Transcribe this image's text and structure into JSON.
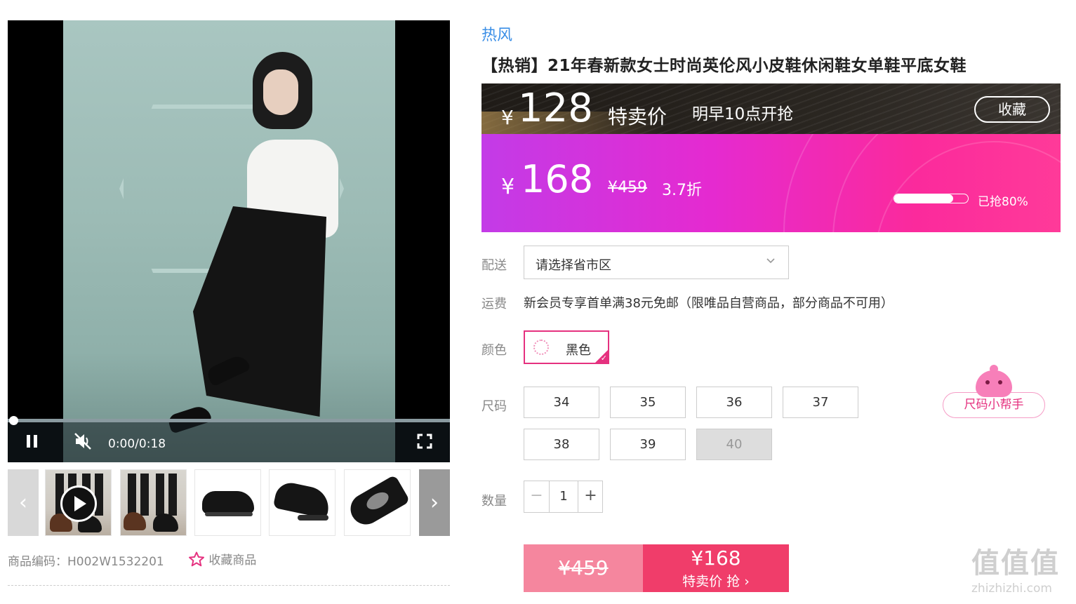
{
  "video": {
    "time": "0:00/0:18",
    "progress": 0.0
  },
  "thumbnails": [
    {
      "name": "thumb-video-legs"
    },
    {
      "name": "thumb-legs"
    },
    {
      "name": "thumb-shoe-side"
    },
    {
      "name": "thumb-shoe-angle"
    },
    {
      "name": "thumb-shoe-top"
    }
  ],
  "meta": {
    "sku_label": "商品编码：",
    "sku_value": "H002W1532201",
    "fav_label": "收藏商品"
  },
  "product": {
    "brand": "热风",
    "title": "【热销】21年春新款女士时尚英伦风小皮鞋休闲鞋女单鞋平底女鞋"
  },
  "flash": {
    "currency": "¥",
    "price": "128",
    "price_label": "特卖价",
    "start_text": "明早10点开抢",
    "collect_label": "收藏"
  },
  "sale": {
    "currency": "¥",
    "price": "168",
    "orig_price": "¥459",
    "discount": "3.7折",
    "sold_percent": 80,
    "sold_text": "已抢80%"
  },
  "delivery": {
    "label": "配送",
    "select_value": "请选择省市区"
  },
  "shipping": {
    "label": "运费",
    "text": "新会员专享首单满38元免邮（限唯品自营商品，部分商品不可用）"
  },
  "color": {
    "label": "颜色",
    "selected": "黑色"
  },
  "size": {
    "label": "尺码",
    "options": [
      {
        "value": "34",
        "available": true
      },
      {
        "value": "35",
        "available": true
      },
      {
        "value": "36",
        "available": true
      },
      {
        "value": "37",
        "available": true
      },
      {
        "value": "38",
        "available": true
      },
      {
        "value": "39",
        "available": true
      },
      {
        "value": "40",
        "available": false
      }
    ],
    "helper_label": "尺码小帮手"
  },
  "quantity": {
    "label": "数量",
    "minus": "−",
    "value": "1",
    "plus": "+"
  },
  "buy": {
    "orig_price": "¥459",
    "price": "¥168",
    "action": "特卖价 抢",
    "chevron": "›"
  },
  "watermark": {
    "logo": "值值值",
    "url": "zhizhizhi.com"
  },
  "colors": {
    "accent": "#e5317f",
    "brand_blue": "#3a8ee6",
    "buy_main": "#f03d6a",
    "buy_orig": "#f5869e"
  }
}
